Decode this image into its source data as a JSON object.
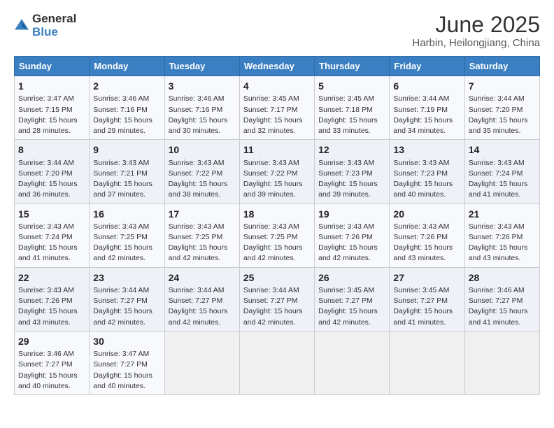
{
  "logo": {
    "general": "General",
    "blue": "Blue"
  },
  "title": "June 2025",
  "subtitle": "Harbin, Heilongjiang, China",
  "days_header": [
    "Sunday",
    "Monday",
    "Tuesday",
    "Wednesday",
    "Thursday",
    "Friday",
    "Saturday"
  ],
  "weeks": [
    [
      {
        "day": "1",
        "info": "Sunrise: 3:47 AM\nSunset: 7:15 PM\nDaylight: 15 hours\nand 28 minutes."
      },
      {
        "day": "2",
        "info": "Sunrise: 3:46 AM\nSunset: 7:16 PM\nDaylight: 15 hours\nand 29 minutes."
      },
      {
        "day": "3",
        "info": "Sunrise: 3:46 AM\nSunset: 7:16 PM\nDaylight: 15 hours\nand 30 minutes."
      },
      {
        "day": "4",
        "info": "Sunrise: 3:45 AM\nSunset: 7:17 PM\nDaylight: 15 hours\nand 32 minutes."
      },
      {
        "day": "5",
        "info": "Sunrise: 3:45 AM\nSunset: 7:18 PM\nDaylight: 15 hours\nand 33 minutes."
      },
      {
        "day": "6",
        "info": "Sunrise: 3:44 AM\nSunset: 7:19 PM\nDaylight: 15 hours\nand 34 minutes."
      },
      {
        "day": "7",
        "info": "Sunrise: 3:44 AM\nSunset: 7:20 PM\nDaylight: 15 hours\nand 35 minutes."
      }
    ],
    [
      {
        "day": "8",
        "info": "Sunrise: 3:44 AM\nSunset: 7:20 PM\nDaylight: 15 hours\nand 36 minutes."
      },
      {
        "day": "9",
        "info": "Sunrise: 3:43 AM\nSunset: 7:21 PM\nDaylight: 15 hours\nand 37 minutes."
      },
      {
        "day": "10",
        "info": "Sunrise: 3:43 AM\nSunset: 7:22 PM\nDaylight: 15 hours\nand 38 minutes."
      },
      {
        "day": "11",
        "info": "Sunrise: 3:43 AM\nSunset: 7:22 PM\nDaylight: 15 hours\nand 39 minutes."
      },
      {
        "day": "12",
        "info": "Sunrise: 3:43 AM\nSunset: 7:23 PM\nDaylight: 15 hours\nand 39 minutes."
      },
      {
        "day": "13",
        "info": "Sunrise: 3:43 AM\nSunset: 7:23 PM\nDaylight: 15 hours\nand 40 minutes."
      },
      {
        "day": "14",
        "info": "Sunrise: 3:43 AM\nSunset: 7:24 PM\nDaylight: 15 hours\nand 41 minutes."
      }
    ],
    [
      {
        "day": "15",
        "info": "Sunrise: 3:43 AM\nSunset: 7:24 PM\nDaylight: 15 hours\nand 41 minutes."
      },
      {
        "day": "16",
        "info": "Sunrise: 3:43 AM\nSunset: 7:25 PM\nDaylight: 15 hours\nand 42 minutes."
      },
      {
        "day": "17",
        "info": "Sunrise: 3:43 AM\nSunset: 7:25 PM\nDaylight: 15 hours\nand 42 minutes."
      },
      {
        "day": "18",
        "info": "Sunrise: 3:43 AM\nSunset: 7:25 PM\nDaylight: 15 hours\nand 42 minutes."
      },
      {
        "day": "19",
        "info": "Sunrise: 3:43 AM\nSunset: 7:26 PM\nDaylight: 15 hours\nand 42 minutes."
      },
      {
        "day": "20",
        "info": "Sunrise: 3:43 AM\nSunset: 7:26 PM\nDaylight: 15 hours\nand 43 minutes."
      },
      {
        "day": "21",
        "info": "Sunrise: 3:43 AM\nSunset: 7:26 PM\nDaylight: 15 hours\nand 43 minutes."
      }
    ],
    [
      {
        "day": "22",
        "info": "Sunrise: 3:43 AM\nSunset: 7:26 PM\nDaylight: 15 hours\nand 43 minutes."
      },
      {
        "day": "23",
        "info": "Sunrise: 3:44 AM\nSunset: 7:27 PM\nDaylight: 15 hours\nand 42 minutes."
      },
      {
        "day": "24",
        "info": "Sunrise: 3:44 AM\nSunset: 7:27 PM\nDaylight: 15 hours\nand 42 minutes."
      },
      {
        "day": "25",
        "info": "Sunrise: 3:44 AM\nSunset: 7:27 PM\nDaylight: 15 hours\nand 42 minutes."
      },
      {
        "day": "26",
        "info": "Sunrise: 3:45 AM\nSunset: 7:27 PM\nDaylight: 15 hours\nand 42 minutes."
      },
      {
        "day": "27",
        "info": "Sunrise: 3:45 AM\nSunset: 7:27 PM\nDaylight: 15 hours\nand 41 minutes."
      },
      {
        "day": "28",
        "info": "Sunrise: 3:46 AM\nSunset: 7:27 PM\nDaylight: 15 hours\nand 41 minutes."
      }
    ],
    [
      {
        "day": "29",
        "info": "Sunrise: 3:46 AM\nSunset: 7:27 PM\nDaylight: 15 hours\nand 40 minutes."
      },
      {
        "day": "30",
        "info": "Sunrise: 3:47 AM\nSunset: 7:27 PM\nDaylight: 15 hours\nand 40 minutes."
      },
      {
        "day": "",
        "info": ""
      },
      {
        "day": "",
        "info": ""
      },
      {
        "day": "",
        "info": ""
      },
      {
        "day": "",
        "info": ""
      },
      {
        "day": "",
        "info": ""
      }
    ]
  ]
}
